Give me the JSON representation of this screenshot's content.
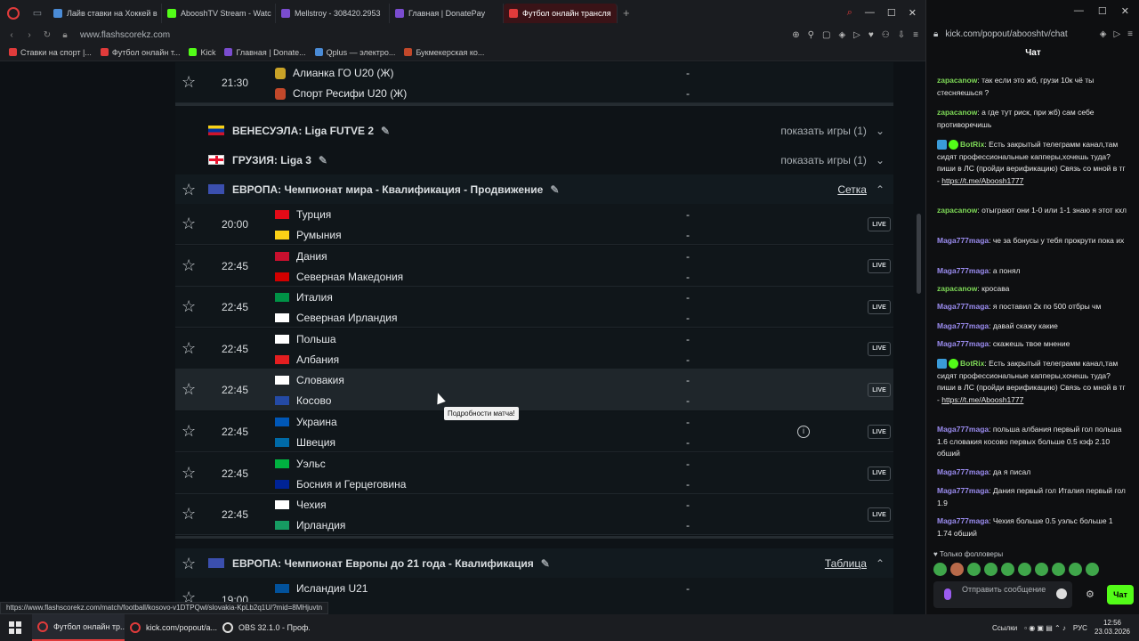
{
  "browser": {
    "tabs": [
      {
        "label": "Лайв ставки на Хоккей в",
        "color": "#4a8bd6"
      },
      {
        "label": "AbooshTV Stream - Watc",
        "color": "#53fc18"
      },
      {
        "label": "Mellstroy - 308420.2953",
        "color": "#7a4ccf"
      },
      {
        "label": "Главная | DonatePay",
        "color": "#7a4ccf"
      },
      {
        "label": "Футбол онлайн трансля",
        "color": "#e03b3b",
        "active": true
      }
    ],
    "url": "www.flashscorekz.com",
    "bookmarks": [
      "Ставки на спорт |...",
      "Футбол онлайн т...",
      "Kick",
      "Главная | Donate...",
      "Qplus — электро...",
      "Букмекерская ко..."
    ]
  },
  "matches_top": {
    "time": "21:30",
    "home": "Алианка ГО U20 (Ж)",
    "away": "Спорт Ресифи U20 (Ж)",
    "dash": "-"
  },
  "leagues": {
    "venezuela": {
      "name": "ВЕНЕСУЭЛА: Liga FUTVE 2",
      "right": "показать игры (1)"
    },
    "georgia": {
      "name": "ГРУЗИЯ: Liga 3",
      "right": "показать игры (1)"
    },
    "europe_wc": {
      "name": "ЕВРОПА: Чемпионат мира - Квалификация - Продвижение",
      "right": "Сетка"
    },
    "europe_u21": {
      "name": "ЕВРОПА: Чемпионат Европы до 21 года - Квалификация",
      "right": "Таблица"
    }
  },
  "matches": [
    {
      "time": "20:00",
      "home": "Турция",
      "away": "Румыния",
      "home_flag": "#e30a17",
      "away_flag": "#fcd116",
      "live": "LIVE"
    },
    {
      "time": "22:45",
      "home": "Дания",
      "away": "Северная Македония",
      "home_flag": "#c8102e",
      "away_flag": "#d20000",
      "live": "LIVE"
    },
    {
      "time": "22:45",
      "home": "Италия",
      "away": "Северная Ирландия",
      "home_flag": "#009246",
      "away_flag": "#ffffff",
      "live": "LIVE"
    },
    {
      "time": "22:45",
      "home": "Польша",
      "away": "Албания",
      "home_flag": "#ffffff",
      "away_flag": "#e41e20",
      "live": "LIVE"
    },
    {
      "time": "22:45",
      "home": "Словакия",
      "away": "Косово",
      "home_flag": "#ffffff",
      "away_flag": "#244aa5",
      "live": "LIVE"
    },
    {
      "time": "22:45",
      "home": "Украина",
      "away": "Швеция",
      "home_flag": "#0057b7",
      "away_flag": "#006aa7",
      "live": "LIVE"
    },
    {
      "time": "22:45",
      "home": "Уэльс",
      "away": "Босния и Герцеговина",
      "home_flag": "#00b140",
      "away_flag": "#002395",
      "live": "LIVE"
    },
    {
      "time": "22:45",
      "home": "Чехия",
      "away": "Ирландия",
      "home_flag": "#ffffff",
      "away_flag": "#169b62",
      "live": "LIVE"
    }
  ],
  "match_bottom": {
    "time": "19:00",
    "home": "Исландия U21",
    "dash": "-"
  },
  "tooltip": "Подробности матча!",
  "status_url": "https://www.flashscorekz.com/match/football/kosovo-v1DTPQwl/slovakia-KpLb2q1U/?mid=8MHjuvtn",
  "chat": {
    "url": "kick.com/popout/abooshtv/chat",
    "title": "Чат",
    "messages": [
      {
        "user": "zapacanow",
        "text": "так если это жб, грузи 10к чё ты стесняешься ?"
      },
      {
        "user": "zapacanow",
        "text": "а где тут риск, при жб) сам себе противоречишь"
      },
      {
        "user": "BotRix",
        "text": "Есть закрытый телеграмм канал,там сидят профессиональные капперы,хочешь туда? пиши в ЛС (пройди верификацию) Связь со мной в тг -",
        "link": "https://t.me/Aboosh1777"
      },
      {
        "user": "zapacanow",
        "text": "отыграют они 1-0 или 1-1 знаю я этот кхл"
      },
      {
        "user": "Maga777maga",
        "text": "че за бонусы у тебя прокрути пока их"
      },
      {
        "user": "Maga777maga",
        "text": "а понял"
      },
      {
        "user": "zapacanow",
        "text": "кросава"
      },
      {
        "user": "Maga777maga",
        "text": "я поставил 2к по 500 отбры чм"
      },
      {
        "user": "Maga777maga",
        "text": "давай скажу какие"
      },
      {
        "user": "Maga777maga",
        "text": "скажешь твое мнение"
      },
      {
        "user": "BotRix",
        "text": "Есть закрытый телеграмм канал,там сидят профессиональные капперы,хочешь туда? пиши в ЛС (пройди верификацию) Связь со мной в тг -",
        "link": "https://t.me/Aboosh1777"
      },
      {
        "user": "Maga777maga",
        "text": "польша албания первый гол польша 1.6 словакия косово первых больше 0.5 кэф 2.10 обший"
      },
      {
        "user": "Maga777maga",
        "text": "да я писал"
      },
      {
        "user": "Maga777maga",
        "text": "Дания первый гол Италия первый гол 1.9"
      },
      {
        "user": "Maga777maga",
        "text": "Чехия больше 0.5 уэльс больше 1 1.74 обший"
      }
    ],
    "followers_only": "Только фолловеры",
    "input_placeholder": "Отправить сообщение",
    "send_label": "Чат"
  },
  "taskbar": {
    "tasks": [
      "Футбол онлайн тр...",
      "kick.com/popout/a...",
      "OBS 32.1.0 - Проф..."
    ],
    "links": "Ссылки",
    "lang": "РУС",
    "time": "12:56",
    "date": "23.03.2026"
  }
}
